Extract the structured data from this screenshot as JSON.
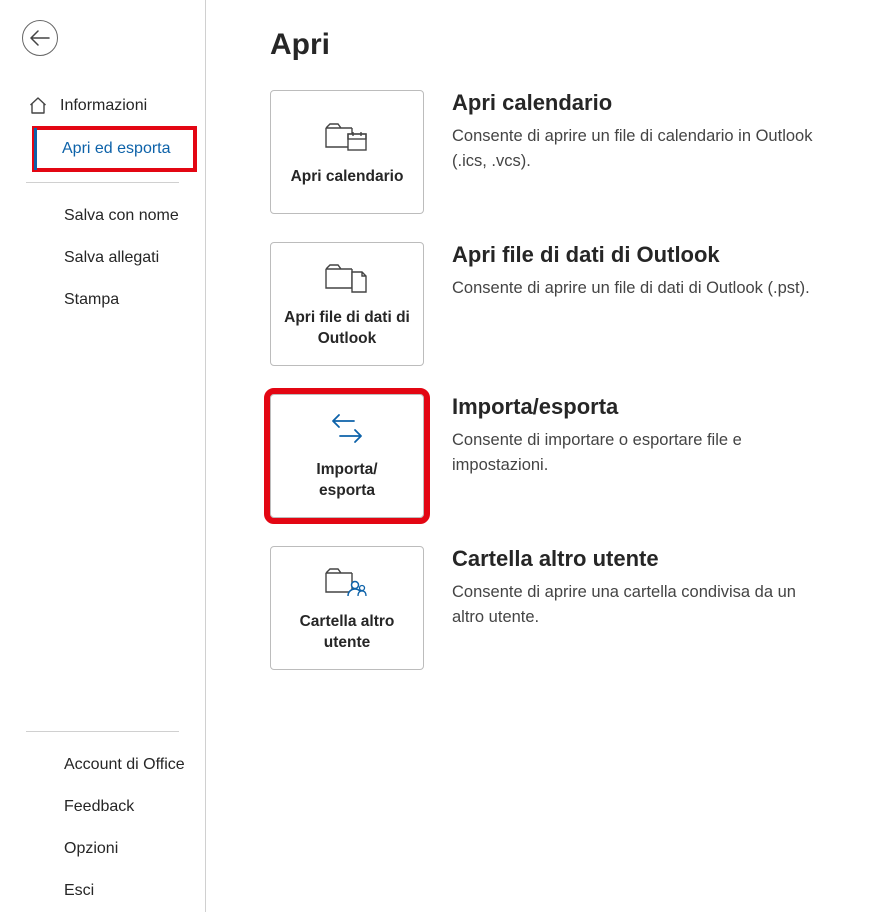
{
  "page_title": "Apri",
  "sidebar": {
    "items_top": [
      {
        "label": "Informazioni",
        "icon": "home",
        "active": false,
        "indent": false
      },
      {
        "label": "Apri ed esporta",
        "icon": null,
        "active": true,
        "indent": true,
        "highlight": true
      },
      {
        "label": "Salva con nome",
        "icon": null,
        "active": false,
        "indent": true
      },
      {
        "label": "Salva allegati",
        "icon": null,
        "active": false,
        "indent": true
      },
      {
        "label": "Stampa",
        "icon": null,
        "active": false,
        "indent": true
      }
    ],
    "items_bottom": [
      {
        "label": "Account di Office"
      },
      {
        "label": "Feedback"
      },
      {
        "label": "Opzioni"
      },
      {
        "label": "Esci"
      }
    ]
  },
  "tiles": [
    {
      "label": "Apri calendario",
      "title": "Apri calendario",
      "desc": "Consente di aprire un file di calendario in Outlook (.ics, .vcs).",
      "icon": "folder-calendar",
      "highlight": false
    },
    {
      "label": "Apri file di dati di Outlook",
      "title": "Apri file di dati di Outlook",
      "desc": "Consente di aprire un file di dati di Outlook (.pst).",
      "icon": "folder-file",
      "highlight": false
    },
    {
      "label": "Importa/\nesporta",
      "title": "Importa/esporta",
      "desc": "Consente di importare o esportare file e impostazioni.",
      "icon": "arrows",
      "highlight": true
    },
    {
      "label": "Cartella altro utente",
      "title": "Cartella altro utente",
      "desc": "Consente di aprire una cartella condivisa da un altro utente.",
      "icon": "folder-user",
      "highlight": false
    }
  ]
}
